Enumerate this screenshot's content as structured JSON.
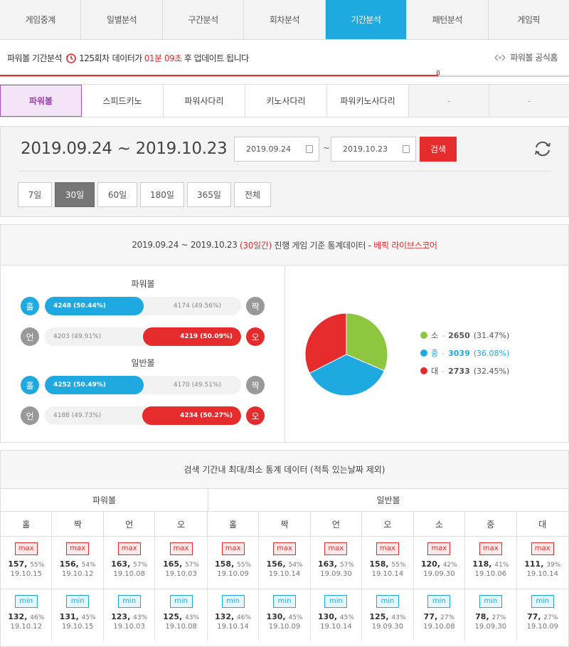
{
  "tabs": [
    "게임중계",
    "일별분석",
    "구간분석",
    "회차분석",
    "기간분석",
    "패턴분석",
    "게임픽"
  ],
  "active_tab": 4,
  "notice": {
    "prefix": "파워볼 기간분석",
    "round": "125회차",
    "mid": "데이터가",
    "time": "01분 09초",
    "suffix": "후 업데이트 됩니다",
    "home": "파워볼 공식홈",
    "progress": 0.77
  },
  "game_tabs": [
    "파워볼",
    "스피드키노",
    "파워사다리",
    "키노사다리",
    "파워키노사다리",
    "-",
    "-"
  ],
  "range": {
    "title": "2019.09.24 ~ 2019.10.23",
    "from": "2019.09.24",
    "tilde": "~",
    "to": "2019.10.23",
    "search": "검색"
  },
  "periods": [
    "7일",
    "30일",
    "60일",
    "180일",
    "365일",
    "전체"
  ],
  "active_period": 1,
  "stats_header": {
    "range": "2019.09.24 ~ 2019.10.23",
    "days": "(30일간)",
    "text": "진행 게임 기준 통계데이터 -",
    "source": "베픽 라이브스코어"
  },
  "powerball": {
    "label": "파워볼",
    "odd": {
      "left": "홀",
      "right": "짝",
      "left_val": "4248 (50.44%)",
      "right_val": "4174 (49.56%)",
      "left_pct": 50.44
    },
    "under": {
      "left": "언",
      "right": "오",
      "left_val": "4203 (49.91%)",
      "right_val": "4219 (50.09%)",
      "right_pct": 50.09
    }
  },
  "normalball": {
    "label": "일반볼",
    "odd": {
      "left": "홀",
      "right": "짝",
      "left_val": "4252 (50.49%)",
      "right_val": "4170 (49.51%)",
      "left_pct": 50.49
    },
    "under": {
      "left": "언",
      "right": "오",
      "left_val": "4188 (49.73%)",
      "right_val": "4234 (50.27%)",
      "right_pct": 50.27
    }
  },
  "pie": [
    {
      "label": "소",
      "value": 2650,
      "pct": "(31.47%)",
      "color": "#8dc63f"
    },
    {
      "label": "중",
      "value": 3039,
      "pct": "(36.08%)",
      "color": "#1ea9e1"
    },
    {
      "label": "대",
      "value": 2733,
      "pct": "(32.45%)",
      "color": "#e52b2b"
    }
  ],
  "table": {
    "title": "검색 기간내 최대/최소 통계 데이터 (적특 있는날짜 제외)",
    "group1": "파워볼",
    "group2": "일반볼",
    "cols": [
      "홀",
      "짝",
      "언",
      "오",
      "홀",
      "짝",
      "언",
      "오",
      "소",
      "중",
      "대"
    ],
    "max_label": "max",
    "min_label": "min",
    "max": [
      {
        "n": "157",
        "p": "55%",
        "d": "19.10.15"
      },
      {
        "n": "156",
        "p": "54%",
        "d": "19.10.12"
      },
      {
        "n": "163",
        "p": "57%",
        "d": "19.10.08"
      },
      {
        "n": "165",
        "p": "57%",
        "d": "19.10.03"
      },
      {
        "n": "158",
        "p": "55%",
        "d": "19.10.09"
      },
      {
        "n": "156",
        "p": "54%",
        "d": "19.10.14"
      },
      {
        "n": "163",
        "p": "57%",
        "d": "19.09.30"
      },
      {
        "n": "158",
        "p": "55%",
        "d": "19.10.14"
      },
      {
        "n": "120",
        "p": "42%",
        "d": "19.09.30"
      },
      {
        "n": "118",
        "p": "41%",
        "d": "19.10.06"
      },
      {
        "n": "111",
        "p": "39%",
        "d": "19.10.14"
      }
    ],
    "min": [
      {
        "n": "132",
        "p": "46%",
        "d": "19.10.12"
      },
      {
        "n": "131",
        "p": "45%",
        "d": "19.10.15"
      },
      {
        "n": "123",
        "p": "43%",
        "d": "19.10.03"
      },
      {
        "n": "125",
        "p": "43%",
        "d": "19.10.08"
      },
      {
        "n": "132",
        "p": "46%",
        "d": "19.10.14"
      },
      {
        "n": "130",
        "p": "45%",
        "d": "19.10.09"
      },
      {
        "n": "130",
        "p": "45%",
        "d": "19.10.14"
      },
      {
        "n": "125",
        "p": "43%",
        "d": "19.09.30"
      },
      {
        "n": "77",
        "p": "27%",
        "d": "19.10.08"
      },
      {
        "n": "78",
        "p": "27%",
        "d": "19.09.30"
      },
      {
        "n": "77",
        "p": "27%",
        "d": "19.10.09"
      }
    ]
  }
}
